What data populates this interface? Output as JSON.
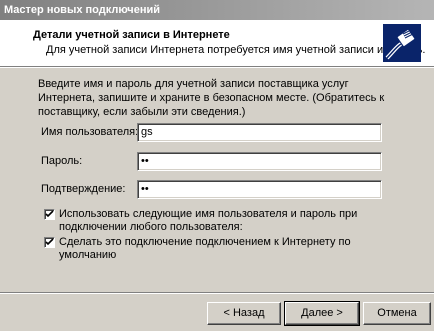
{
  "window": {
    "title": "Мастер новых подключений"
  },
  "header": {
    "title": "Детали учетной записи в Интернете",
    "subtitle": "Для учетной записи Интернета потребуется имя учетной записи и пароль.",
    "icon": "network-cable-icon"
  },
  "intro": "Введите имя и пароль для учетной записи поставщика услуг Интернета, запишите и храните в безопасном месте. (Обратитесь к поставщику, если забыли эти сведения.)",
  "form": {
    "username": {
      "label": "Имя пользователя:",
      "value": "gs"
    },
    "password": {
      "label": "Пароль:",
      "value": "••"
    },
    "confirm": {
      "label": "Подтверждение:",
      "value": "••"
    }
  },
  "options": [
    {
      "label": "Использовать следующие имя пользователя и пароль при подключении любого пользователя:",
      "checked": true
    },
    {
      "label": "Сделать это подключение подключением к Интернету по умолчанию",
      "checked": true
    }
  ],
  "buttons": {
    "back": "< Назад",
    "next": "Далее >",
    "cancel": "Отмена"
  }
}
